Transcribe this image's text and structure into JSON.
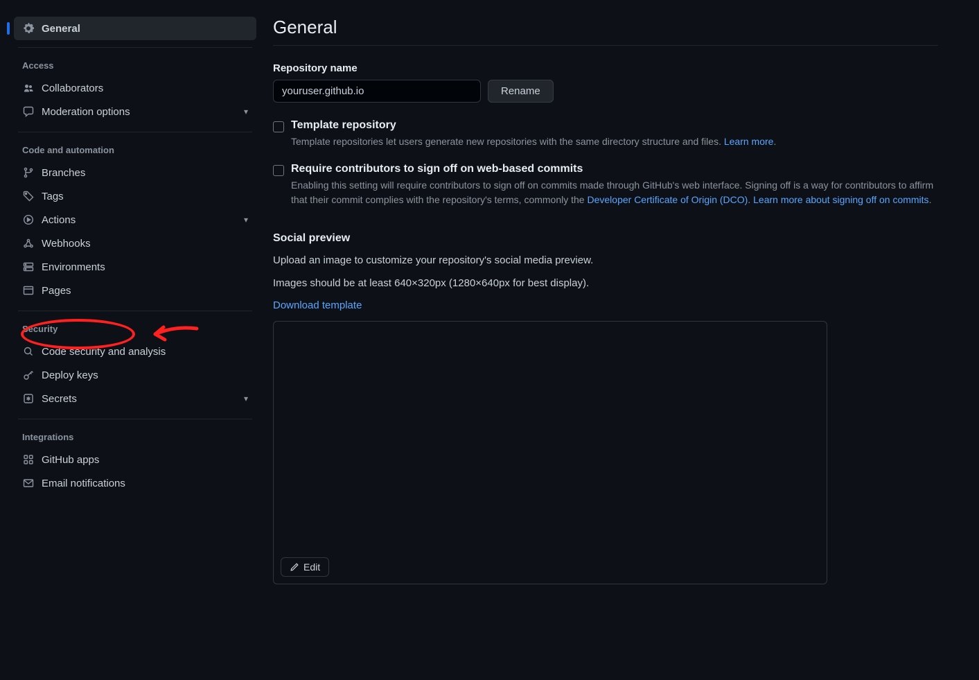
{
  "page": {
    "title": "General"
  },
  "sidebar": {
    "general": "General",
    "groups": [
      {
        "heading": "Access",
        "items": [
          {
            "id": "collaborators",
            "label": "Collaborators",
            "expandable": false
          },
          {
            "id": "moderation",
            "label": "Moderation options",
            "expandable": true
          }
        ]
      },
      {
        "heading": "Code and automation",
        "items": [
          {
            "id": "branches",
            "label": "Branches",
            "expandable": false
          },
          {
            "id": "tags",
            "label": "Tags",
            "expandable": false
          },
          {
            "id": "actions",
            "label": "Actions",
            "expandable": true
          },
          {
            "id": "webhooks",
            "label": "Webhooks",
            "expandable": false
          },
          {
            "id": "environments",
            "label": "Environments",
            "expandable": false
          },
          {
            "id": "pages",
            "label": "Pages",
            "expandable": false
          }
        ]
      },
      {
        "heading": "Security",
        "items": [
          {
            "id": "code-security",
            "label": "Code security and analysis",
            "expandable": false
          },
          {
            "id": "deploy-keys",
            "label": "Deploy keys",
            "expandable": false
          },
          {
            "id": "secrets",
            "label": "Secrets",
            "expandable": true
          }
        ]
      },
      {
        "heading": "Integrations",
        "items": [
          {
            "id": "github-apps",
            "label": "GitHub apps",
            "expandable": false
          },
          {
            "id": "email-notifications",
            "label": "Email notifications",
            "expandable": false
          }
        ]
      }
    ]
  },
  "repo_name": {
    "label": "Repository name",
    "value": "youruser.github.io",
    "rename_button": "Rename"
  },
  "template_repo": {
    "title": "Template repository",
    "desc": "Template repositories let users generate new repositories with the same directory structure and files. ",
    "link": "Learn more"
  },
  "signoff": {
    "title": "Require contributors to sign off on web-based commits",
    "desc1": "Enabling this setting will require contributors to sign off on commits made through GitHub's web interface. Signing off is a way for contributors to affirm that their commit complies with the repository's terms, commonly the ",
    "link1": "Developer Certificate of Origin (DCO)",
    "desc2": ". ",
    "link2": "Learn more about signing off on commits"
  },
  "social": {
    "title": "Social preview",
    "para1": "Upload an image to customize your repository's social media preview.",
    "para2": "Images should be at least 640×320px (1280×640px for best display).",
    "download": "Download template",
    "edit": "Edit"
  }
}
